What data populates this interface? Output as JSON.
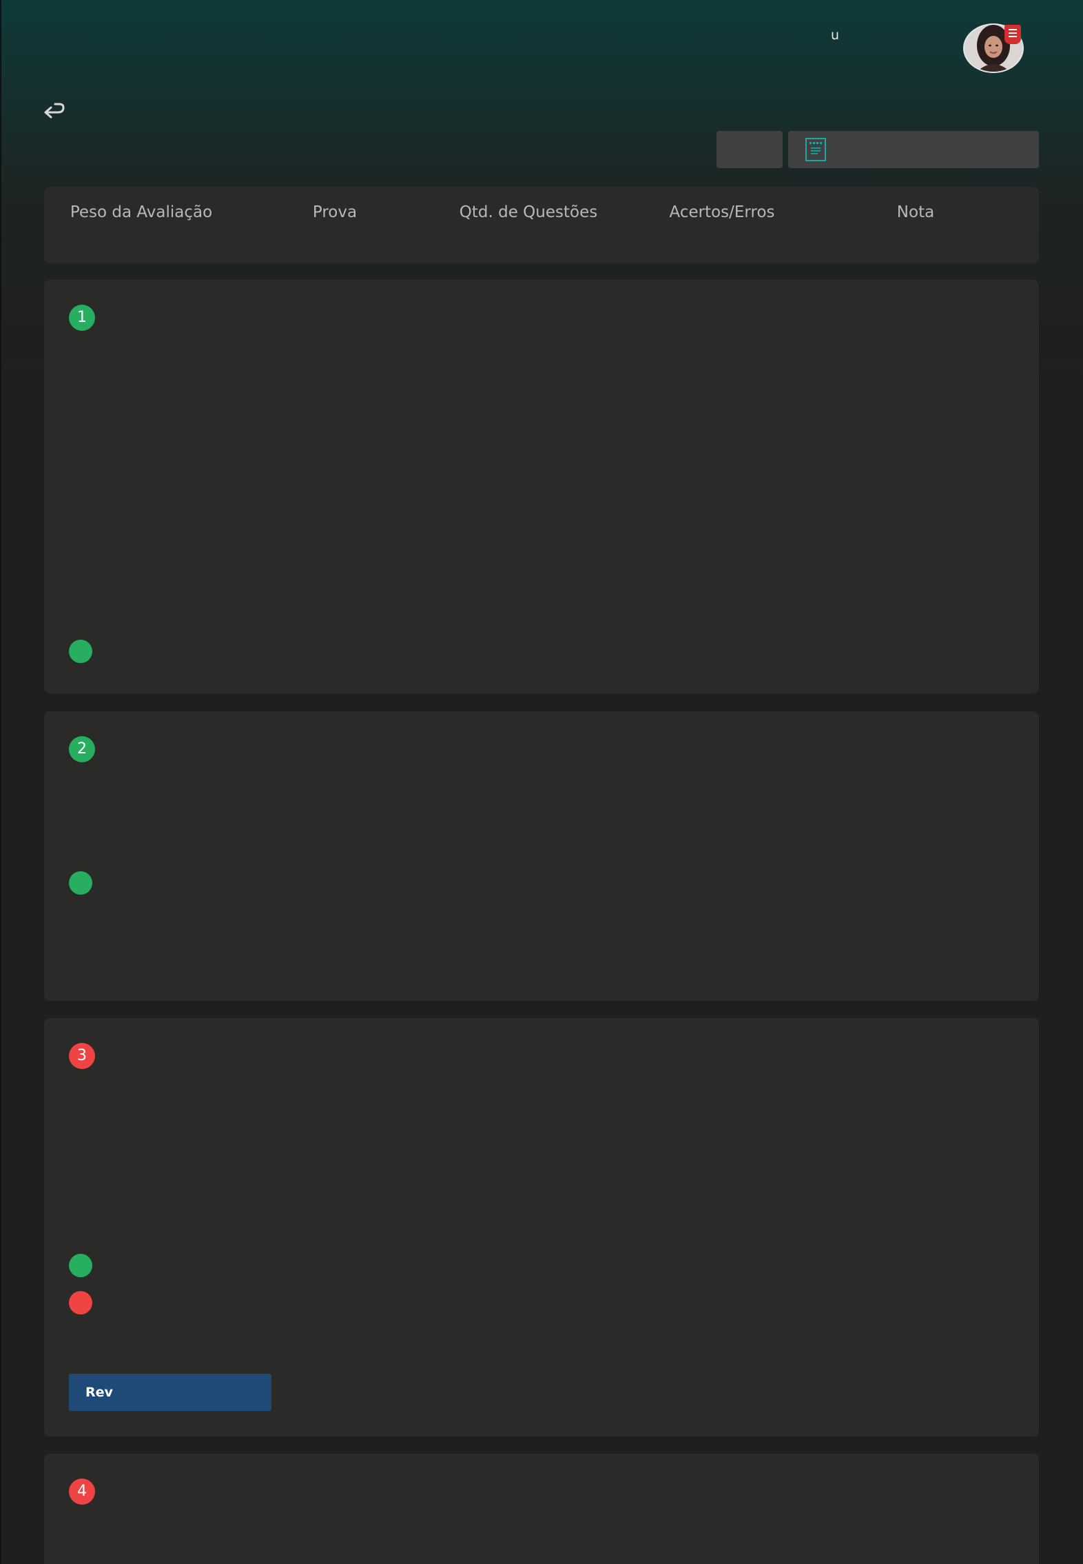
{
  "header": {
    "user_initial": "u",
    "avatar_icon": "user-avatar",
    "badge_icon": "document-badge-icon"
  },
  "toolbar": {
    "back_icon": "return-arrow-icon",
    "document_icon": "document-icon"
  },
  "summary": {
    "columns": [
      "Peso da Avaliação",
      "Prova",
      "Qtd. de Questões",
      "Acertos/Erros",
      "Nota"
    ]
  },
  "questions": [
    {
      "number": "1",
      "status_color": "#27ae60",
      "options": [
        "#27ae60"
      ]
    },
    {
      "number": "2",
      "status_color": "#27ae60",
      "options": [
        "#27ae60"
      ]
    },
    {
      "number": "3",
      "status_color": "#ef4444",
      "options": [
        "#27ae60",
        "#ef4444"
      ],
      "review_label": "Rev"
    },
    {
      "number": "4",
      "status_color": "#ef4444",
      "options": []
    }
  ],
  "colors": {
    "correct": "#27ae60",
    "wrong": "#ef4444",
    "review_button": "#1f4a78",
    "card_bg": "#2a2a28",
    "header_gradient_top": "#0e3a3a"
  }
}
